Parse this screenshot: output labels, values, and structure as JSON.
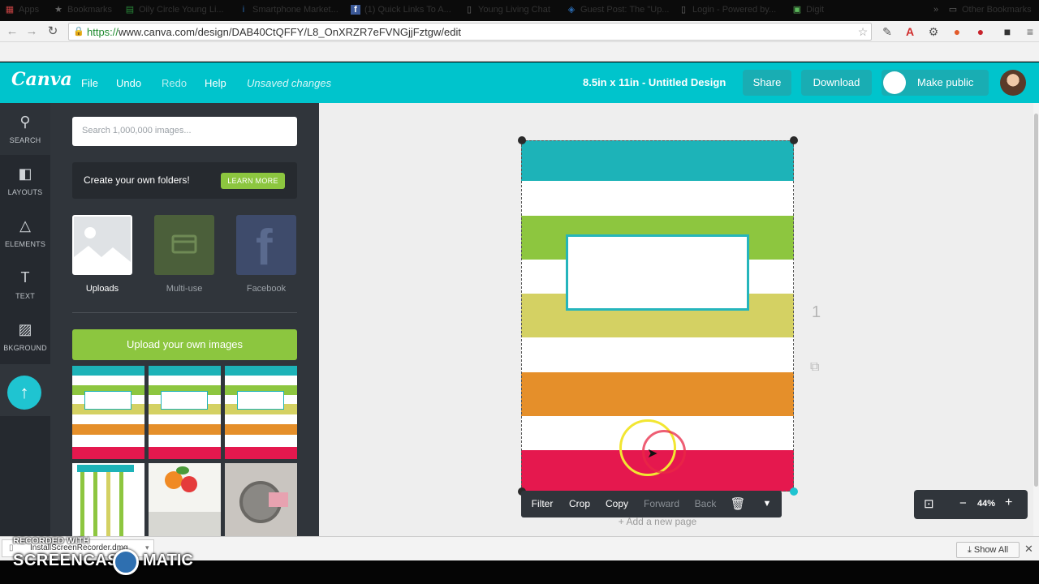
{
  "browser": {
    "url_scheme": "https://",
    "url_rest": "www.canva.com/design/DAB40CtQFFY/L8_OnXRZR7eFVNGjjFztgw/edit"
  },
  "bookmarks": {
    "items": [
      {
        "label": "Apps",
        "icon": "apps-grid-icon"
      },
      {
        "label": "Bookmarks",
        "icon": "star-icon"
      },
      {
        "label": "Oily Circle Young Li...",
        "icon": "sheet-icon"
      },
      {
        "label": "Smartphone Market...",
        "icon": "info-icon"
      },
      {
        "label": "(1) Quick Links To A...",
        "icon": "facebook-icon"
      },
      {
        "label": "Young Living Chat",
        "icon": "page-icon"
      },
      {
        "label": "Guest Post: The \"Up...",
        "icon": "layers-icon"
      },
      {
        "label": "Login - Powered by...",
        "icon": "page-icon"
      },
      {
        "label": "Digit",
        "icon": "digit-icon"
      }
    ],
    "other": "Other Bookmarks"
  },
  "header": {
    "logo": "Canva",
    "menu": {
      "file": "File",
      "undo": "Undo",
      "redo": "Redo",
      "help": "Help",
      "status": "Unsaved changes"
    },
    "title": "8.5in x 11in - Untitled Design",
    "share": "Share",
    "download": "Download",
    "make_public": "Make public"
  },
  "leftnav": {
    "items": [
      {
        "label": "SEARCH"
      },
      {
        "label": "LAYOUTS"
      },
      {
        "label": "ELEMENTS"
      },
      {
        "label": "TEXT"
      },
      {
        "label": "BKGROUND"
      }
    ]
  },
  "panel": {
    "search_placeholder": "Search 1,000,000 images...",
    "folders_text": "Create your own folders!",
    "learn_more": "LEARN MORE",
    "tiles": [
      {
        "label": "Uploads"
      },
      {
        "label": "Multi-use"
      },
      {
        "label": "Facebook"
      }
    ],
    "upload_button": "Upload your own images"
  },
  "canvas": {
    "page_number": "1",
    "add_page": "+ Add a new page",
    "band_colors": [
      "#1db3b8",
      "#8dc63f",
      "#d4d163",
      "#e58f2a",
      "#e5184e"
    ]
  },
  "toolbar": {
    "filter": "Filter",
    "crop": "Crop",
    "copy": "Copy",
    "forward": "Forward",
    "back": "Back"
  },
  "zoom": {
    "level": "44%"
  },
  "downloads": {
    "file": "InstallScreenRecorder.dmg",
    "show_all": "Show All"
  },
  "watermark": {
    "recorded": "RECORDED WITH",
    "brand_left": "SCREENCAST",
    "brand_right": "MATIC"
  }
}
